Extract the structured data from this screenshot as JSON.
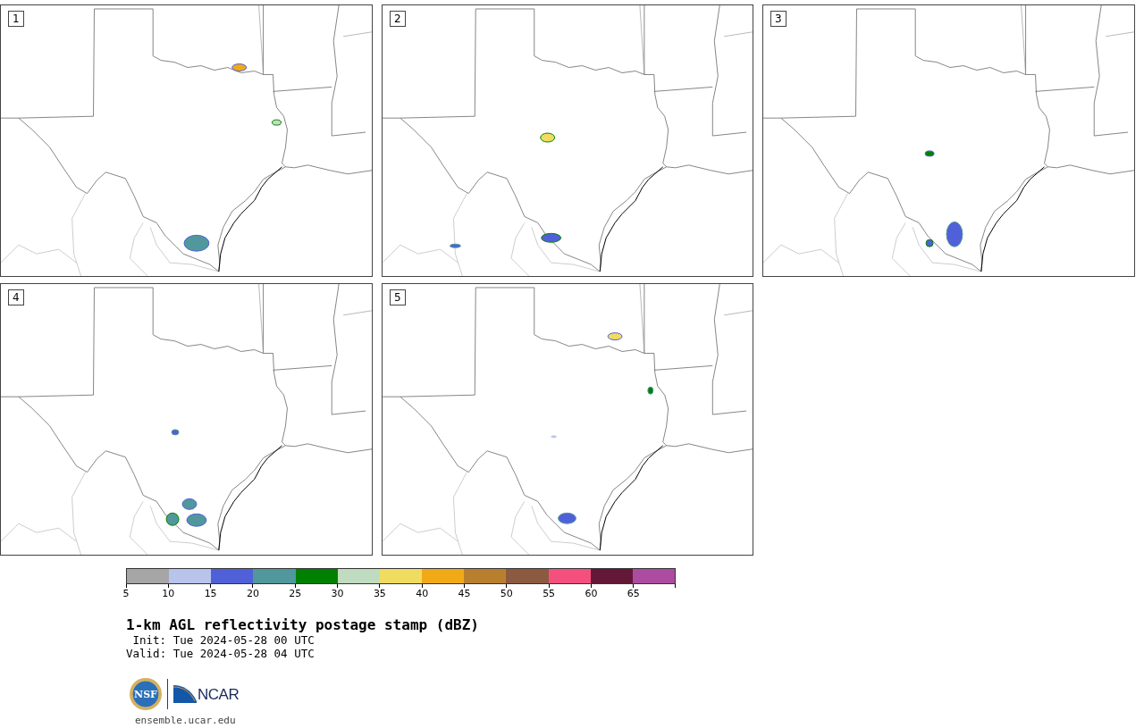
{
  "panels": [
    {
      "label": "1"
    },
    {
      "label": "2"
    },
    {
      "label": "3"
    },
    {
      "label": "4"
    },
    {
      "label": "5"
    }
  ],
  "colorbar": {
    "segments": [
      {
        "label": "5",
        "color": "#a6a6a6"
      },
      {
        "label": "10",
        "color": "#b8c4ec"
      },
      {
        "label": "15",
        "color": "#5060d8"
      },
      {
        "label": "20",
        "color": "#50989c"
      },
      {
        "label": "25",
        "color": "#008000"
      },
      {
        "label": "30",
        "color": "#c0dcc0"
      },
      {
        "label": "35",
        "color": "#f0dc60"
      },
      {
        "label": "40",
        "color": "#f0aa18"
      },
      {
        "label": "45",
        "color": "#b8802e"
      },
      {
        "label": "50",
        "color": "#8c5a40"
      },
      {
        "label": "55",
        "color": "#f4507e"
      },
      {
        "label": "60",
        "color": "#641838"
      },
      {
        "label": "65",
        "color": "#ac4ca0"
      }
    ]
  },
  "caption": {
    "title": "1-km AGL reflectivity postage stamp (dBZ)",
    "init": "Init: Tue 2024-05-28 00 UTC",
    "valid": "Valid: Tue 2024-05-28 04 UTC"
  },
  "logos": {
    "nsf": "NSF",
    "ncar": "NCAR",
    "url": "ensemble.ucar.edu"
  }
}
